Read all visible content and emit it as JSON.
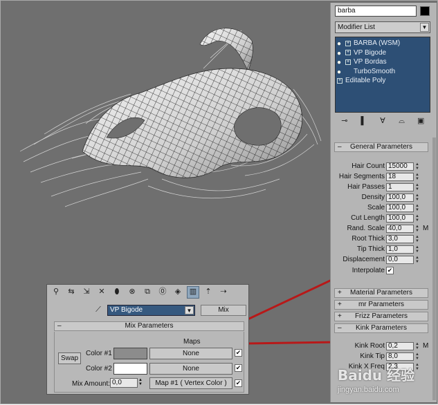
{
  "command_panel": {
    "object_name": "barba",
    "object_color": "#000000",
    "modifier_list_label": "Modifier List",
    "stack": [
      {
        "label": "BARBA (WSM)",
        "expand": true
      },
      {
        "label": "VP Bigode",
        "expand": true
      },
      {
        "label": "VP Bordas",
        "expand": true
      },
      {
        "label": "TurboSmooth",
        "expand": false
      },
      {
        "label": "Editable Poly",
        "expand": true
      }
    ],
    "general_parameters": {
      "title": "General Parameters",
      "toggle": "–",
      "params": [
        {
          "label": "Hair Count",
          "value": "15000"
        },
        {
          "label": "Hair Segments",
          "value": "18"
        },
        {
          "label": "Hair Passes",
          "value": "1"
        },
        {
          "label": "Density",
          "value": "100,0"
        },
        {
          "label": "Scale",
          "value": "100,0"
        },
        {
          "label": "Cut Length",
          "value": "100,0"
        },
        {
          "label": "Rand. Scale",
          "value": "40,0",
          "m": "M"
        },
        {
          "label": "Root Thick",
          "value": "3,0"
        },
        {
          "label": "Tip Thick",
          "value": "1,0"
        },
        {
          "label": "Displacement",
          "value": "0,0"
        }
      ],
      "interpolate_label": "Interpolate",
      "interpolate_checked": "✔"
    },
    "collapsed_rollouts": [
      {
        "title": "Material Parameters",
        "toggle": "+"
      },
      {
        "title": "mr Parameters",
        "toggle": "+"
      },
      {
        "title": "Frizz Parameters",
        "toggle": "+"
      }
    ],
    "kink_parameters": {
      "title": "Kink Parameters",
      "toggle": "–",
      "params": [
        {
          "label": "Kink Root",
          "value": "0,2",
          "m": "M"
        },
        {
          "label": "Kink Tip",
          "value": "8,0"
        },
        {
          "label": "Kink X Freq",
          "value": "2,3"
        }
      ]
    }
  },
  "mix_dialog": {
    "modifier_selected": "VP Bigode",
    "mix_button": "Mix",
    "rollout_title": "Mix Parameters",
    "rollout_toggle": "–",
    "maps_header": "Maps",
    "swap_label": "Swap",
    "color1_label": "Color #1",
    "color1_value": "#8c8c8c",
    "color2_label": "Color #2",
    "color2_value": "#ffffff",
    "map1": "None",
    "map2": "None",
    "mix_amount_label": "Mix Amount:",
    "mix_amount_value": "0,0",
    "mix_map": "Map #1  ( Vertex Color )",
    "checks": [
      "✔",
      "✔",
      "✔"
    ]
  },
  "watermark": {
    "brand": "Baidu 经验",
    "url": "jingyan.baidu.com"
  },
  "colors": {
    "viewport_bg": "#6f6f6f",
    "stack_bg": "#2d4f75",
    "callout_line": "#b81818"
  }
}
